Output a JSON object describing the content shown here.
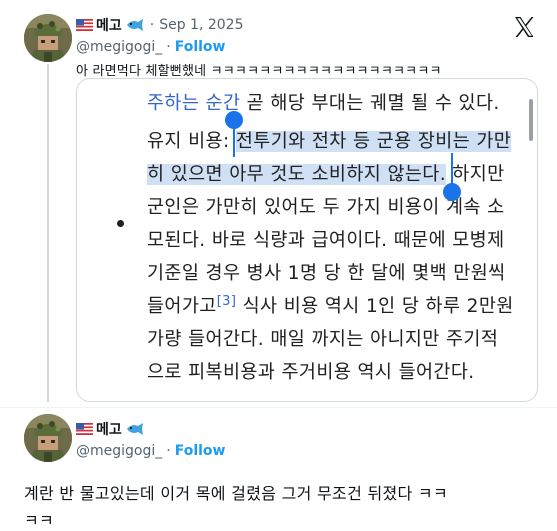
{
  "post": {
    "flag_icon": "us-flag-icon",
    "author_name": "메고",
    "fish_icon": "fish-emoji-icon",
    "separator": "·",
    "date": "Sep 1, 2025",
    "handle": "@megigogi_",
    "handle_separator": "·",
    "follow_label": "Follow",
    "close_icon": "x-logo-icon",
    "text": "아 라면먹다 체할뻔했네 ㅋㅋㅋㅋㅋㅋㅋㅋㅋㅋㅋㅋㅋㅋㅋㅋㅋㅋㅋ"
  },
  "quoted_image": {
    "line0_link": "주하는 순간",
    "line0_rest": " 곧 해당 부대는 궤멸 될 수 있다.",
    "line1_plain": "유지 비용: ",
    "line1_hl": "전투기와 전차 등 군용 장비는 가만",
    "line2_hl": "히 있으면 아무 것도 소비하지 않는다.",
    "line2_rest": " 하지만",
    "line3": "군인은 가만히 있어도 두 가지 비용이 계속 소",
    "line4": "모된다. 바로 식량과 급여이다. 때문에 모병제",
    "line5": "기준일 경우 병사 1명 당 한 달에 몇백 만원씩",
    "line6_a": "들어가고",
    "line6_ref": "[3]",
    "line6_b": " 식사 비용 역시 1인 당 하루 2만원",
    "line7": "가량 들어간다. 매일 까지는 아니지만 주기적",
    "line8": "으로 피복비용과 주거비용 역시 들어간다."
  },
  "reply": {
    "flag_icon": "us-flag-icon",
    "author_name": "메고",
    "fish_icon": "fish-emoji-icon",
    "handle": "@megigogi_",
    "handle_separator": "·",
    "follow_label": "Follow",
    "text_line1": "계란 반 물고있는데 이거 목에 걸렸음 그거 무조건 뒤졌다 ㅋㅋ",
    "text_line2": "ㅋㅋ"
  }
}
